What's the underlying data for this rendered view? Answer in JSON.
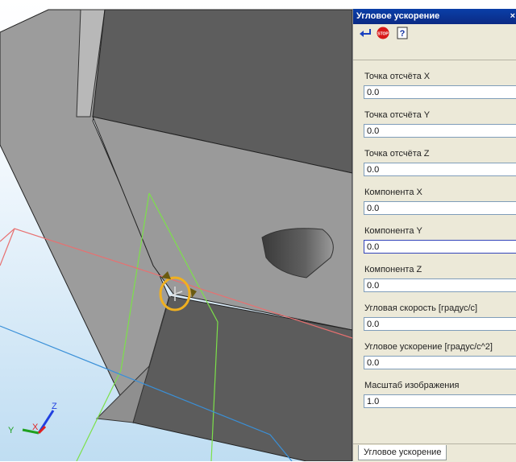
{
  "panel": {
    "title": "Угловое ускорение",
    "close_glyph": "×",
    "toolbar": [
      {
        "name": "apply-icon",
        "glyph": "↵"
      },
      {
        "name": "stop-icon",
        "glyph": "STOP"
      },
      {
        "name": "help-icon",
        "glyph": "?"
      }
    ],
    "fields": [
      {
        "label": "Точка отсчёта X",
        "value": "0.0"
      },
      {
        "label": "Точка отсчёта Y",
        "value": "0.0"
      },
      {
        "label": "Точка отсчёта Z",
        "value": "0.0"
      },
      {
        "label": "Компонента X",
        "value": "0.0"
      },
      {
        "label": "Компонента Y",
        "value": "0.0"
      },
      {
        "label": "Компонента Z",
        "value": "0.0"
      },
      {
        "label": "Угловая скорость [градус/с]",
        "value": "0.0"
      },
      {
        "label": "Угловое ускорение [градус/с^2]",
        "value": "0.0"
      },
      {
        "label": "Масштаб изображения",
        "value": "1.0"
      }
    ],
    "tab_label": "Угловое ускорение"
  },
  "viewport": {
    "axes": {
      "x": "X",
      "y": "Y",
      "z": "Z"
    },
    "colors": {
      "axis_x": "#e02020",
      "axis_y": "#20a020",
      "axis_z": "#2040e0",
      "gizmo": "#f0b020",
      "plane_green": "#7ce04a",
      "plane_red": "#e87070",
      "plane_blue": "#3a90d8"
    }
  }
}
